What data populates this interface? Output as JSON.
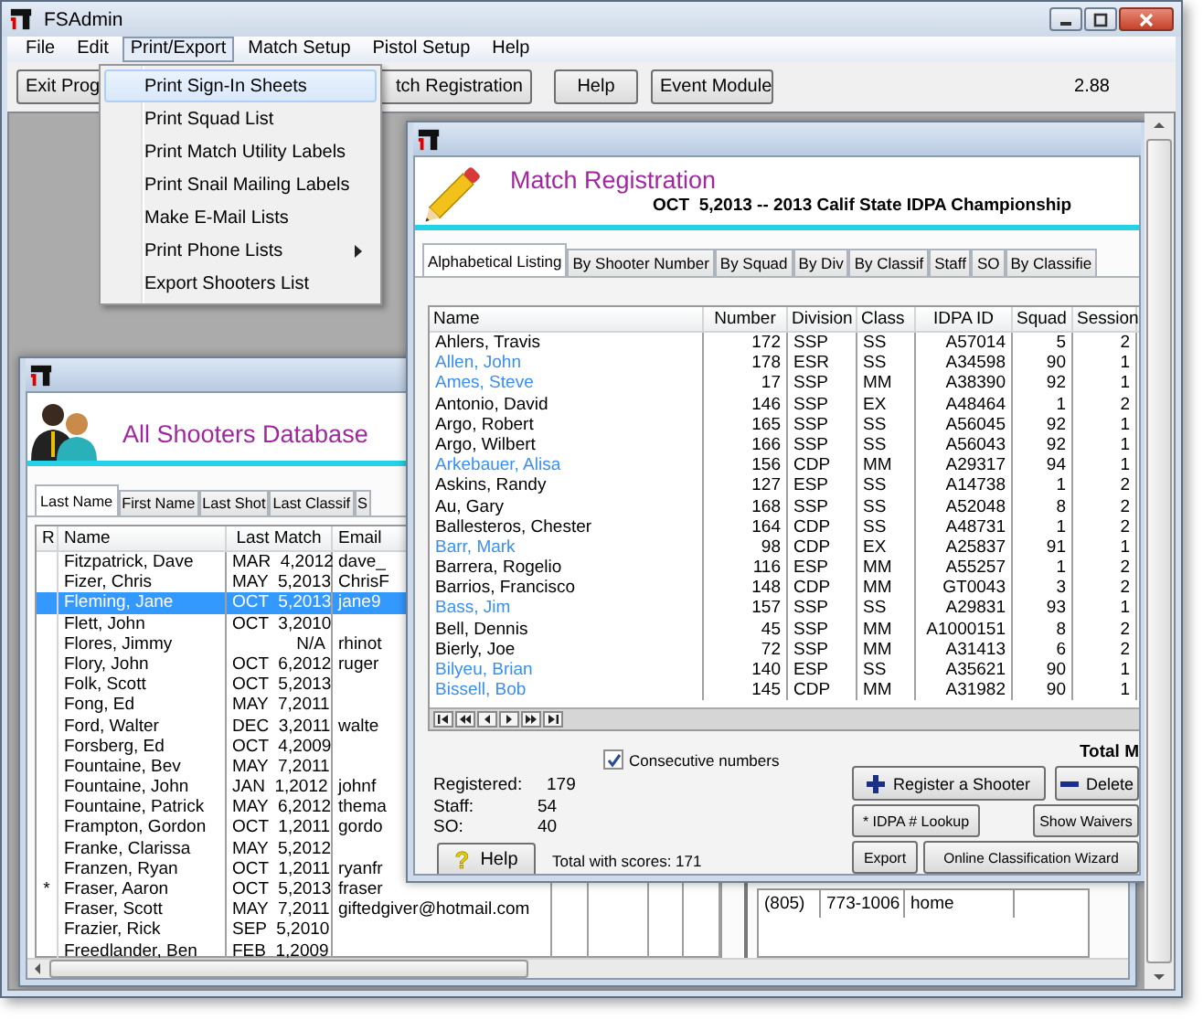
{
  "window": {
    "title": "FSAdmin"
  },
  "menu_bar": [
    {
      "label": "File",
      "selected": false
    },
    {
      "label": "Edit",
      "selected": false
    },
    {
      "label": "Print/Export",
      "selected": true
    },
    {
      "label": "Match Setup",
      "selected": false
    },
    {
      "label": "Pistol Setup",
      "selected": false
    },
    {
      "label": "Help",
      "selected": false
    }
  ],
  "dropdown_menu": [
    {
      "label": "Print Sign-In Sheets",
      "selected": true,
      "submenu": false
    },
    {
      "label": "Print Squad List",
      "selected": false,
      "submenu": false
    },
    {
      "label": "Print Match Utility Labels",
      "selected": false,
      "submenu": false
    },
    {
      "label": "Print Snail Mailing Labels",
      "selected": false,
      "submenu": false
    },
    {
      "label": "Make E-Mail Lists",
      "selected": false,
      "submenu": false
    },
    {
      "label": "Print Phone Lists",
      "selected": false,
      "submenu": true
    },
    {
      "label": "Export Shooters List",
      "selected": false,
      "submenu": false
    }
  ],
  "toolbar": {
    "buttons": [
      "Exit Prog",
      "tch Registration",
      "Help",
      "Event Module"
    ],
    "version": "2.88"
  },
  "shooters_window": {
    "title": "All Shooters Database",
    "tabs": [
      {
        "label": "Last Name",
        "selected": true
      },
      {
        "label": "First Name",
        "selected": false
      },
      {
        "label": "Last Shot",
        "selected": false
      },
      {
        "label": "Last Classif",
        "selected": false
      },
      {
        "label": "S",
        "selected": false
      }
    ],
    "columns": [
      "R",
      "Name",
      "Last Match",
      "Email"
    ],
    "rows": [
      {
        "name": "Fitzpatrick, Dave",
        "last_match": "MAR  4,2012",
        "email": "dave_",
        "selected": false
      },
      {
        "name": "Fizer, Chris",
        "last_match": "MAY  5,2013",
        "email": "ChrisF",
        "selected": false
      },
      {
        "name": "Fleming, Jane",
        "last_match": "OCT  5,2013",
        "email": "jane9",
        "selected": true
      },
      {
        "name": "Flett, John",
        "last_match": "OCT  3,2010",
        "selected": false
      },
      {
        "name": "Flores, Jimmy",
        "last_match": "N/A",
        "email": "rhinot",
        "selected": false
      },
      {
        "name": "Flory, John",
        "last_match": "OCT  6,2012",
        "email": "ruger",
        "selected": false
      },
      {
        "name": "Folk, Scott",
        "last_match": "OCT  5,2013",
        "selected": false
      },
      {
        "name": "Fong, Ed",
        "last_match": "MAY  7,2011",
        "selected": false
      },
      {
        "name": "Ford, Walter",
        "last_match": "DEC  3,2011",
        "email": "walte",
        "selected": false
      },
      {
        "name": "Forsberg, Ed",
        "last_match": "OCT  4,2009",
        "selected": false
      },
      {
        "name": "Fountaine, Bev",
        "last_match": "MAY  7,2011",
        "selected": false
      },
      {
        "name": "Fountaine, John",
        "last_match": "JAN  1,2012",
        "email": "johnf",
        "selected": false
      },
      {
        "name": "Fountaine, Patrick",
        "last_match": "MAY  6,2012",
        "email": "thema",
        "selected": false
      },
      {
        "name": "Frampton, Gordon",
        "last_match": "OCT  1,2011",
        "email": "gordo",
        "selected": false
      },
      {
        "name": "Franke, Clarissa",
        "last_match": "MAY  5,2012",
        "selected": false
      },
      {
        "name": "Franzen, Ryan",
        "last_match": "OCT  1,2011",
        "email": "ryanfr",
        "selected": false
      },
      {
        "r": "*",
        "name": "Fraser, Aaron",
        "last_match": "OCT  5,2013",
        "email": "fraser",
        "selected": false
      },
      {
        "name": "Fraser, Scott",
        "last_match": "MAY  7,2011",
        "email": "giftedgiver@hotmail.com",
        "selected": false
      },
      {
        "name": "Frazier, Rick",
        "last_match": "SEP  5,2010",
        "selected": false
      },
      {
        "name": "Freedlander, Ben",
        "last_match": "FEB  1,2009",
        "selected": false
      }
    ],
    "phones": [
      {
        "area": "(805)",
        "number": "773-1006",
        "type": "home"
      }
    ]
  },
  "registration_window": {
    "title": "Match Registration",
    "subtitle": "OCT  5,2013 -- 2013 Calif State IDPA Championship",
    "tabs": [
      {
        "label": "Alphabetical Listing",
        "selected": true
      },
      {
        "label": "By Shooter Number",
        "selected": false
      },
      {
        "label": "By Squad",
        "selected": false
      },
      {
        "label": "By Div",
        "selected": false
      },
      {
        "label": "By Classif",
        "selected": false
      },
      {
        "label": "Staff",
        "selected": false
      },
      {
        "label": "SO",
        "selected": false
      },
      {
        "label": "By Classifie",
        "selected": false
      }
    ],
    "columns": [
      "Name",
      "Number",
      "Division",
      "Class",
      "IDPA ID",
      "Squad",
      "Session"
    ],
    "rows": [
      {
        "name": "Ahlers, Travis",
        "number": "172",
        "division": "SSP",
        "class": "SS",
        "idpa_id": "A57014",
        "squad": "5",
        "session": "2",
        "color": "#000000"
      },
      {
        "name": "Allen, John",
        "number": "178",
        "division": "ESR",
        "class": "SS",
        "idpa_id": "A34598",
        "squad": "90",
        "session": "1",
        "color": "#3a8ff0"
      },
      {
        "name": "Ames, Steve",
        "number": "17",
        "division": "SSP",
        "class": "MM",
        "idpa_id": "A38390",
        "squad": "92",
        "session": "1",
        "color": "#3a8ff0"
      },
      {
        "name": "Antonio, David",
        "number": "146",
        "division": "SSP",
        "class": "EX",
        "idpa_id": "A48464",
        "squad": "1",
        "session": "2",
        "color": "#000000"
      },
      {
        "name": "Argo, Robert",
        "number": "165",
        "division": "SSP",
        "class": "SS",
        "idpa_id": "A56045",
        "squad": "92",
        "session": "1",
        "color": "#000000"
      },
      {
        "name": "Argo, Wilbert",
        "number": "166",
        "division": "SSP",
        "class": "SS",
        "idpa_id": "A56043",
        "squad": "92",
        "session": "1",
        "color": "#000000"
      },
      {
        "name": "Arkebauer, Alisa",
        "number": "156",
        "division": "CDP",
        "class": "MM",
        "idpa_id": "A29317",
        "squad": "94",
        "session": "1",
        "color": "#3a8ff0"
      },
      {
        "name": "Askins, Randy",
        "number": "127",
        "division": "ESP",
        "class": "SS",
        "idpa_id": "A14738",
        "squad": "1",
        "session": "2",
        "color": "#000000"
      },
      {
        "name": "Au, Gary",
        "number": "168",
        "division": "SSP",
        "class": "SS",
        "idpa_id": "A52048",
        "squad": "8",
        "session": "2",
        "color": "#000000"
      },
      {
        "name": "Ballesteros, Chester",
        "number": "164",
        "division": "CDP",
        "class": "SS",
        "idpa_id": "A48731",
        "squad": "1",
        "session": "2",
        "color": "#000000"
      },
      {
        "name": "Barr, Mark",
        "number": "98",
        "division": "CDP",
        "class": "EX",
        "idpa_id": "A25837",
        "squad": "91",
        "session": "1",
        "color": "#3a8ff0"
      },
      {
        "name": "Barrera, Rogelio",
        "number": "116",
        "division": "ESP",
        "class": "MM",
        "idpa_id": "A55257",
        "squad": "1",
        "session": "2",
        "color": "#000000"
      },
      {
        "name": "Barrios, Francisco",
        "number": "148",
        "division": "CDP",
        "class": "MM",
        "idpa_id": "GT0043",
        "squad": "3",
        "session": "2",
        "color": "#000000"
      },
      {
        "name": "Bass, Jim",
        "number": "157",
        "division": "SSP",
        "class": "SS",
        "idpa_id": "A29831",
        "squad": "93",
        "session": "1",
        "color": "#3a8ff0"
      },
      {
        "name": "Bell, Dennis",
        "number": "45",
        "division": "SSP",
        "class": "MM",
        "idpa_id": "A1000151",
        "squad": "8",
        "session": "2",
        "color": "#000000"
      },
      {
        "name": "Bierly, Joe",
        "number": "72",
        "division": "SSP",
        "class": "MM",
        "idpa_id": "A31413",
        "squad": "6",
        "session": "2",
        "color": "#000000"
      },
      {
        "name": "Bilyeu, Brian",
        "number": "140",
        "division": "ESP",
        "class": "SS",
        "idpa_id": "A35621",
        "squad": "90",
        "session": "1",
        "color": "#3a8ff0"
      },
      {
        "name": "Bissell, Bob",
        "number": "145",
        "division": "CDP",
        "class": "MM",
        "idpa_id": "A31982",
        "squad": "90",
        "session": "1",
        "color": "#3a8ff0"
      }
    ],
    "consecutive_numbers": {
      "label": "Consecutive numbers",
      "checked": true
    },
    "stats": [
      {
        "label": "Registered:",
        "value": "179"
      },
      {
        "label": "Staff:",
        "value": "54"
      },
      {
        "label": "SO:",
        "value": "40"
      }
    ],
    "help_button": {
      "icon": "?",
      "label": "Help"
    },
    "total_with_scores": "Total with scores: 171",
    "total_label": "Total M",
    "buttons": [
      {
        "label": "Register a Shooter",
        "kind": "add"
      },
      {
        "label": "Delete",
        "kind": "remove"
      },
      {
        "label": "* IDPA # Lookup",
        "kind": "plain"
      },
      {
        "label": "Show Waivers",
        "kind": "plain"
      },
      {
        "label": "Export",
        "kind": "plain"
      },
      {
        "label": "Online Classification Wizard",
        "kind": "plain"
      }
    ]
  }
}
